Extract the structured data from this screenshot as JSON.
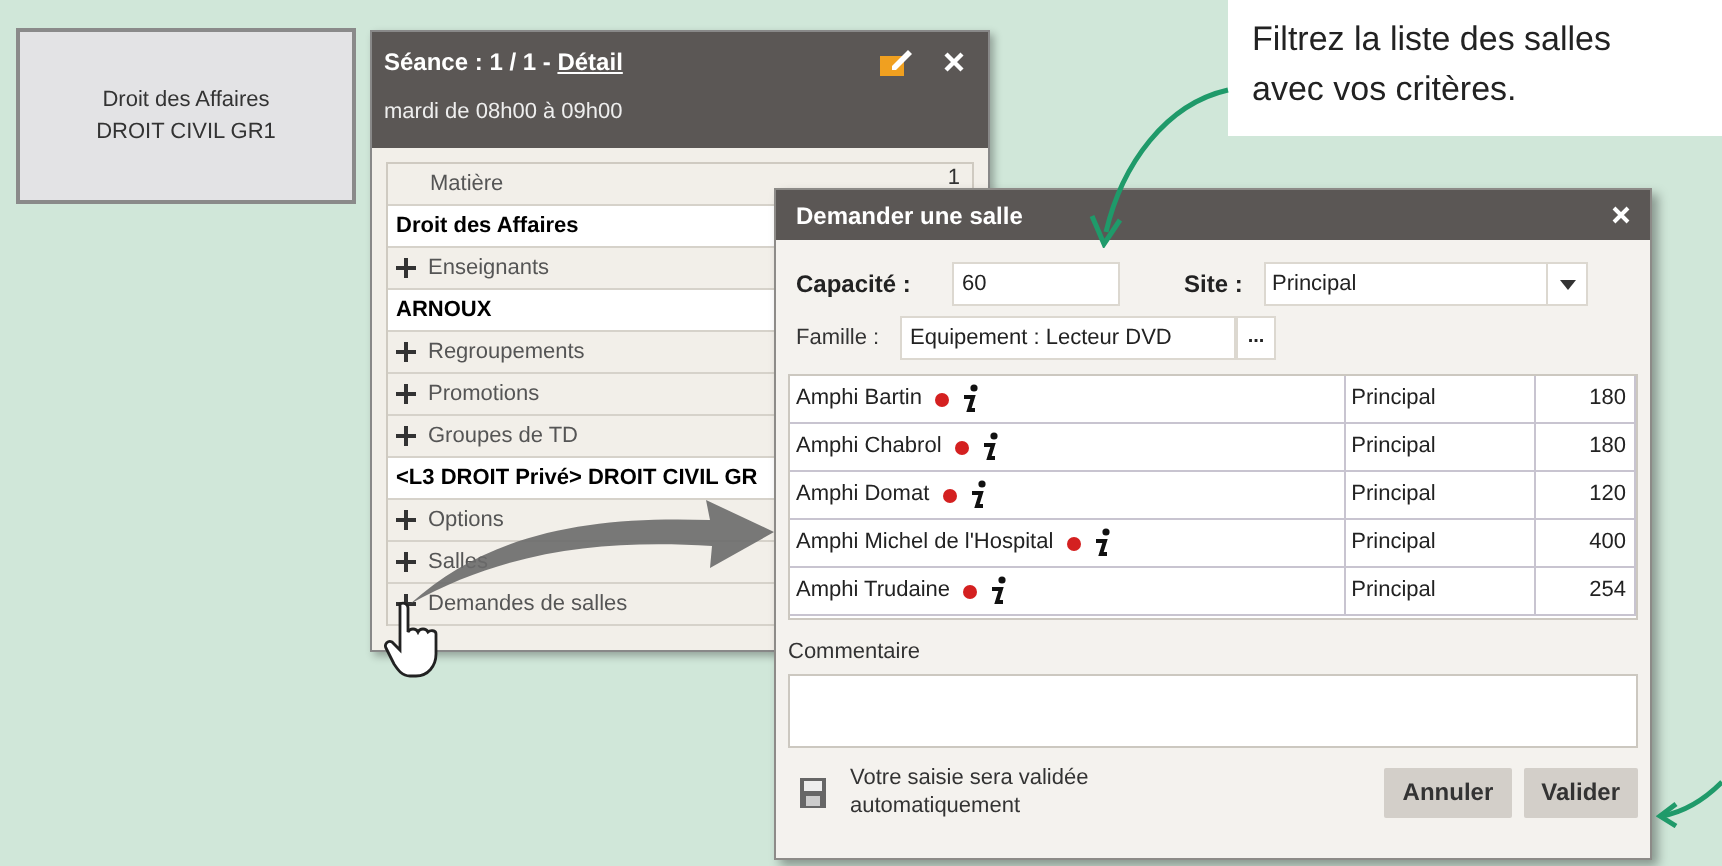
{
  "course_card": {
    "subject": "Droit des Affaires",
    "group": "DROIT CIVIL GR1"
  },
  "session_panel": {
    "title": "Séance : 1 / 1 - ",
    "detail_link": "Détail",
    "subtitle": "mardi de 08h00 à 09h00",
    "rows": [
      {
        "kind": "label",
        "text": "Matière",
        "count": "1"
      },
      {
        "kind": "value",
        "text": "Droit des Affaires"
      },
      {
        "kind": "section",
        "text": "Enseignants"
      },
      {
        "kind": "value",
        "text": "ARNOUX"
      },
      {
        "kind": "section",
        "text": "Regroupements"
      },
      {
        "kind": "section",
        "text": "Promotions"
      },
      {
        "kind": "section",
        "text": "Groupes de TD"
      },
      {
        "kind": "value",
        "text": "<L3 DROIT Privé> DROIT CIVIL GR"
      },
      {
        "kind": "section",
        "text": "Options"
      },
      {
        "kind": "section",
        "text": "Salles"
      },
      {
        "kind": "section",
        "text": "Demandes de salles"
      }
    ]
  },
  "dialog": {
    "title": "Demander une salle",
    "capacity_label": "Capacité :",
    "capacity_value": "60",
    "site_label": "Site :",
    "site_value": "Principal",
    "family_label": "Famille :",
    "family_value": "Equipement : Lecteur DVD",
    "family_button": "...",
    "rooms": [
      {
        "name": "Amphi Bartin",
        "site": "Principal",
        "capacity": "180"
      },
      {
        "name": "Amphi Chabrol",
        "site": "Principal",
        "capacity": "180"
      },
      {
        "name": "Amphi Domat",
        "site": "Principal",
        "capacity": "120"
      },
      {
        "name": "Amphi Michel de l'Hospital",
        "site": "Principal",
        "capacity": "400"
      },
      {
        "name": "Amphi Trudaine",
        "site": "Principal",
        "capacity": "254"
      }
    ],
    "comment_label": "Commentaire",
    "autosave_note": "Votre saisie sera validée automatiquement",
    "buttons": [
      "Annuler",
      "Valider"
    ]
  },
  "callout": {
    "lines": [
      "Filtrez la liste des salles",
      "avec vos critères."
    ]
  }
}
